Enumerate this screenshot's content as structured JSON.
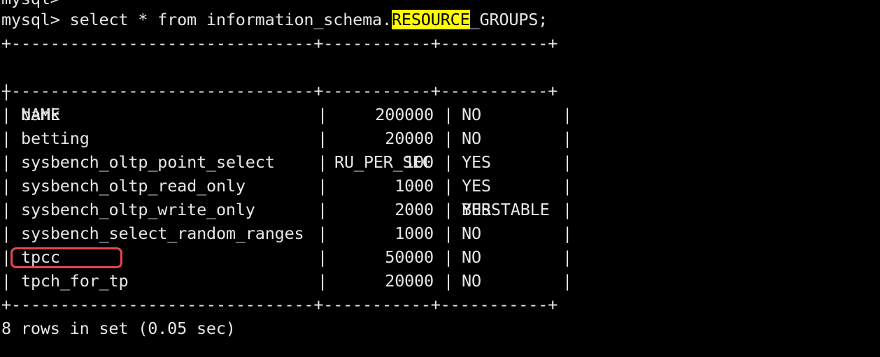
{
  "terminal": {
    "prev_prompt": "mysql>",
    "prompt": "mysql>",
    "command_before": " select * from information_schema.",
    "command_highlight": "RESOURCE",
    "command_after": "_GROUPS;",
    "highlight_color": "#ffff00",
    "annotation_color": "#e5484d"
  },
  "table": {
    "border": "+-------------------------------+-----------+-----------+",
    "headers": [
      "NAME",
      "RU_PER_SEC",
      "BURSTABLE"
    ],
    "rows": [
      {
        "name": "bank",
        "ru": "200000",
        "burst": "NO"
      },
      {
        "name": "betting",
        "ru": "20000",
        "burst": "NO"
      },
      {
        "name": "sysbench_oltp_point_select",
        "ru": "100",
        "burst": "YES"
      },
      {
        "name": "sysbench_oltp_read_only",
        "ru": "1000",
        "burst": "YES"
      },
      {
        "name": "sysbench_oltp_write_only",
        "ru": "2000",
        "burst": "YES"
      },
      {
        "name": "sysbench_select_random_ranges",
        "ru": "1000",
        "burst": "NO"
      },
      {
        "name": "tpcc",
        "ru": "50000",
        "burst": "NO"
      },
      {
        "name": "tpch_for_tp",
        "ru": "20000",
        "burst": "NO"
      }
    ],
    "footer": "8 rows in set (0.05 sec)"
  }
}
